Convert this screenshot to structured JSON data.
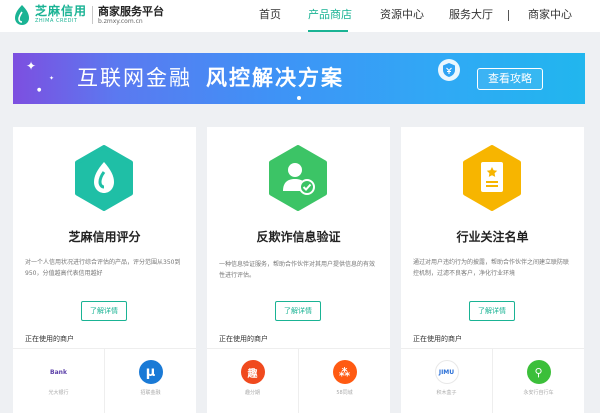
{
  "header": {
    "logo_cn": "芝麻信用",
    "logo_en": "ZHIMA CREDIT",
    "platform_title": "商家服务平台",
    "platform_url": "b.zmxy.com.cn",
    "nav": [
      "首页",
      "产品商店",
      "资源中心",
      "服务大厅",
      "商家中心"
    ],
    "active_nav": "产品商店"
  },
  "banner": {
    "text_part1": "互联网金融",
    "text_part2": "风控解决方案",
    "button_label": "查看攻略"
  },
  "cards": [
    {
      "title": "芝麻信用评分",
      "desc": "对一个人信用状况进行综合评估的产品，评分范围从350到950，分值越高代表信用越好",
      "button": "了解详情",
      "merchants_label": "正在使用的商户",
      "merchants": [
        {
          "name": "光大银行",
          "logo_text": "Bank"
        },
        {
          "name": "招联金融",
          "logo_text": "μ"
        }
      ]
    },
    {
      "title": "反欺诈信息验证",
      "desc": "一种信息验证服务，帮助合作伙伴对其用户提供信息的有效性进行评估。",
      "button": "了解详情",
      "merchants_label": "正在使用的商户",
      "merchants": [
        {
          "name": "趣分期",
          "logo_text": "趣"
        },
        {
          "name": "58同城",
          "logo_text": "⁂"
        }
      ]
    },
    {
      "title": "行业关注名单",
      "desc": "通过对用户违约行为的披露，帮助合作伙伴之间建立联防联控机制，过滤不良客户，净化行业环境",
      "button": "了解详情",
      "merchants_label": "正在使用的商户",
      "merchants": [
        {
          "name": "积木盒子",
          "logo_text": "JIMU"
        },
        {
          "name": "永安行自行车",
          "logo_text": "⚲"
        }
      ]
    }
  ],
  "colors": {
    "brand": "#1ab394",
    "card1_icon": "#1fbfa6",
    "card2_icon": "#3cc466",
    "card3_icon": "#f7b500"
  }
}
